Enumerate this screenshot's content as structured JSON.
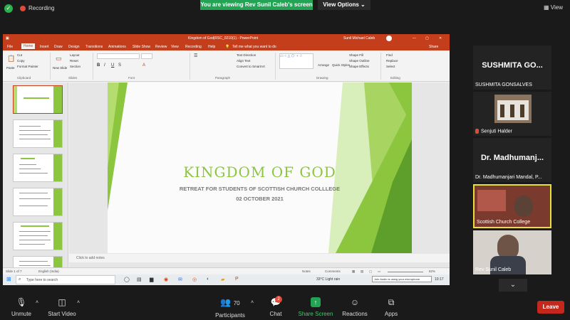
{
  "topbar": {
    "recording": "Recording",
    "banner": "You are viewing Rev Sunil Caleb's screen",
    "view_options": "View Options",
    "view": "View"
  },
  "ppt": {
    "title": "Kingdom of God|RSC_0210(1)  -  PowerPoint",
    "user": "Sunil Michael Caleb",
    "tabs": [
      "File",
      "Home",
      "Insert",
      "Draw",
      "Design",
      "Transitions",
      "Animations",
      "Slide Show",
      "Review",
      "View",
      "Recording",
      "Help"
    ],
    "tellme": "Tell me what you want to do",
    "share": "Share",
    "ribbon": {
      "paste": "Paste",
      "cut": "Cut",
      "copy": "Copy",
      "format_painter": "Format Painter",
      "new_slide": "New Slide",
      "layout": "Layout",
      "reset": "Reset",
      "section": "Section",
      "text_direction": "Text Direction",
      "align_text": "Align Text",
      "convert_smartart": "Convert to SmartArt",
      "arrange": "Arrange",
      "quick_styles": "Quick Styles",
      "shape_fill": "Shape Fill",
      "shape_outline": "Shape Outline",
      "shape_effects": "Shape Effects",
      "find": "Find",
      "replace": "Replace",
      "select": "Select",
      "groups": [
        "Clipboard",
        "Slides",
        "Font",
        "Paragraph",
        "Drawing",
        "Editing"
      ]
    },
    "slide": {
      "title": "KINGDOM  OF GOD",
      "subtitle": "RETREAT FOR STUDENTS OF SCOTTISH CHURCH COLLLEGE",
      "date": "02 OCTOBER 2021"
    },
    "thumb_numbers": [
      "1",
      "2",
      "3",
      "4",
      "5",
      "6"
    ],
    "notes": "Click to add notes",
    "status": {
      "slide_of": "Slide 1 of 7",
      "language": "English (India)",
      "notes": "Notes",
      "comments": "Comments",
      "zoom": "82%"
    }
  },
  "taskbar": {
    "search": "Type here to search",
    "weather": "33°C  Light rain",
    "tip": "Join Audio is using your microphone",
    "time": "10:17"
  },
  "participants": [
    {
      "big": "SUSHMITA  GO...",
      "label": "SUSHMITA GONSALVES"
    },
    {
      "label": "Senjuti Halder"
    },
    {
      "big": "Dr.  Madhumanj...",
      "label": "Dr. Madhumanjari Mandal, P..."
    },
    {
      "label": "Scottish Church College"
    },
    {
      "label": "Rev Sunil Caleb"
    }
  ],
  "zoombar": {
    "unmute": "Unmute",
    "start_video": "Start Video",
    "participants": "Participants",
    "participants_count": "70",
    "chat": "Chat",
    "chat_badge": "2",
    "share_screen": "Share Screen",
    "reactions": "Reactions",
    "apps": "Apps",
    "leave": "Leave"
  }
}
